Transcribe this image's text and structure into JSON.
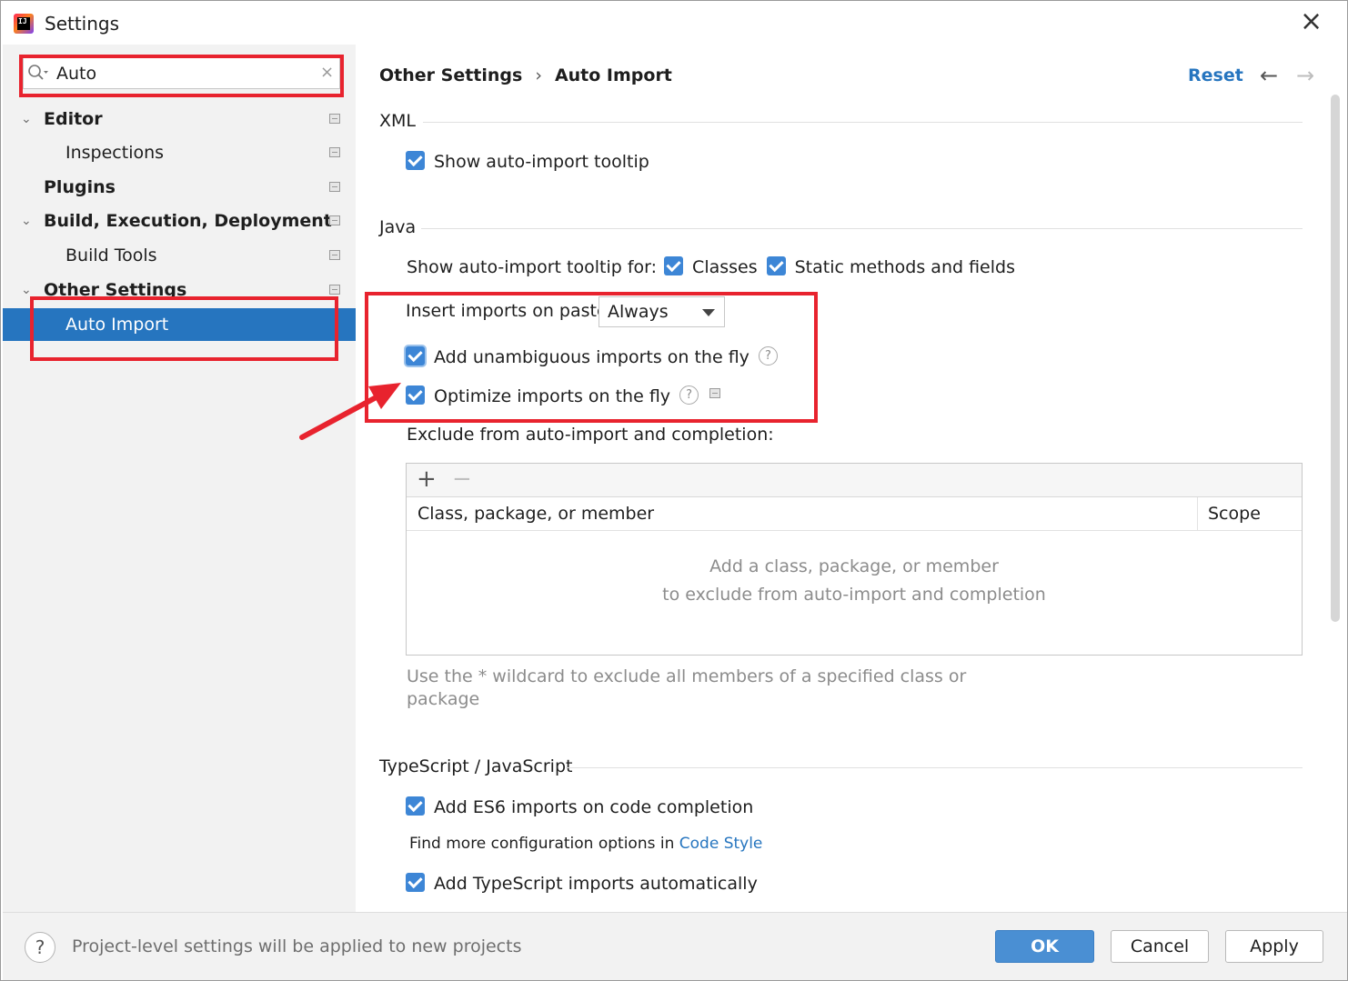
{
  "window": {
    "title": "Settings",
    "app_icon": "intellij-idea-icon",
    "app_icon_text": "IJ",
    "close_glyph": "×"
  },
  "sidebar": {
    "search": {
      "value": "Auto",
      "clear_glyph": "×"
    },
    "items": [
      {
        "label": "Editor",
        "expanded": true,
        "bold": true
      },
      {
        "label": "Inspections",
        "bold": false
      },
      {
        "label": "Plugins",
        "bold": true
      },
      {
        "label": "Build, Execution, Deployment",
        "expanded": true,
        "bold": true
      },
      {
        "label": "Build Tools",
        "bold": false
      },
      {
        "label": "Other Settings",
        "expanded": true,
        "bold": true
      },
      {
        "label": "Auto Import",
        "bold": false,
        "selected": true
      }
    ],
    "chevron_glyph": "⌄"
  },
  "header": {
    "breadcrumb_parent": "Other Settings",
    "breadcrumb_sep": "›",
    "breadcrumb_current": "Auto Import",
    "reset_label": "Reset",
    "back_glyph": "←",
    "forward_glyph": "→"
  },
  "xml": {
    "title": "XML",
    "show_tooltip_label": "Show auto-import tooltip",
    "show_tooltip_checked": true
  },
  "java": {
    "title": "Java",
    "tooltip_for_label": "Show auto-import tooltip for:",
    "classes_label": "Classes",
    "classes_checked": true,
    "static_label": "Static methods and fields",
    "static_checked": true,
    "insert_on_paste_label": "Insert imports on paste:",
    "insert_on_paste_value": "Always",
    "unambiguous_label": "Add unambiguous imports on the fly",
    "unambiguous_checked": true,
    "optimize_label": "Optimize imports on the fly",
    "optimize_checked": true,
    "help_glyph": "?",
    "exclude_label": "Exclude from auto-import and completion:",
    "table": {
      "add_glyph": "+",
      "remove_glyph": "−",
      "col_member": "Class, package, or member",
      "col_scope": "Scope",
      "empty_line1": "Add a class, package, or member",
      "empty_line2": "to exclude from auto-import and completion"
    },
    "hint_line1": "Use the * wildcard to exclude all members of a specified class or",
    "hint_line2": "package"
  },
  "typescript": {
    "title": "TypeScript / JavaScript",
    "es6_label": "Add ES6 imports on code completion",
    "es6_checked": true,
    "find_more_prefix": "Find more configuration options in",
    "code_style_link": "Code Style",
    "ts_auto_label": "Add TypeScript imports automatically",
    "ts_auto_checked": true
  },
  "footer": {
    "help_glyph": "?",
    "status_text": "Project-level settings will be applied to new projects",
    "ok_label": "OK",
    "cancel_label": "Cancel",
    "apply_label": "Apply"
  },
  "colors": {
    "selection": "#2675bf",
    "checkbox": "#3d86d6",
    "link": "#2675bf",
    "annotation": "#e8232e"
  }
}
